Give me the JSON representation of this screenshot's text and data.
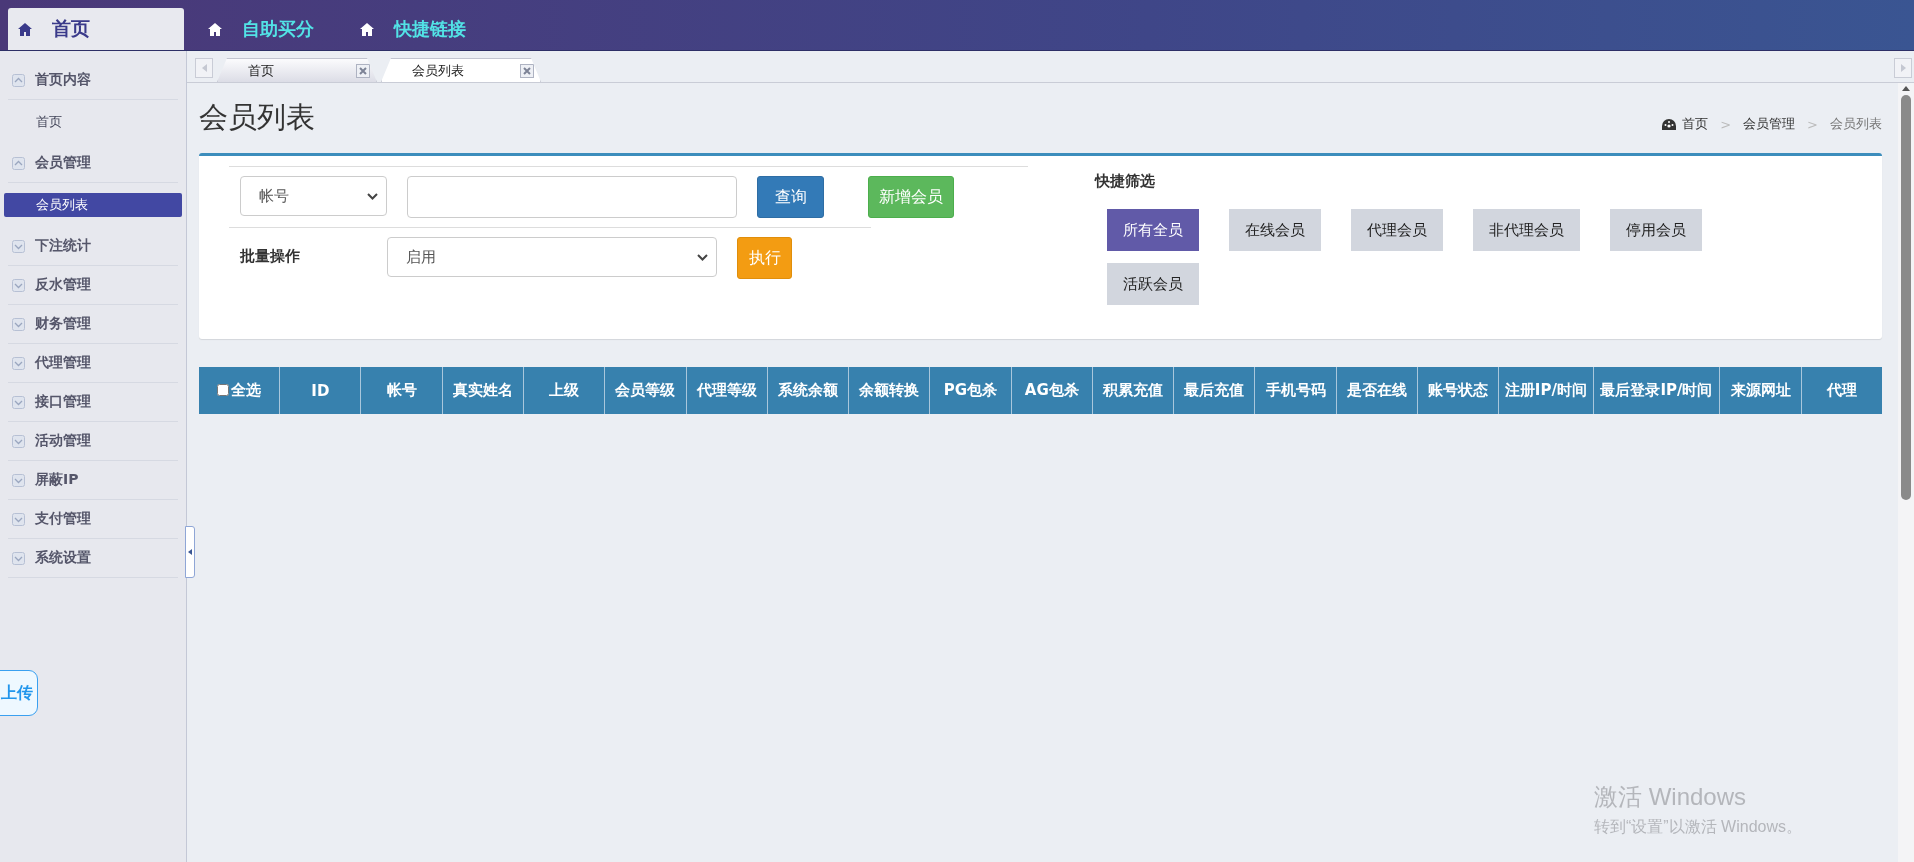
{
  "top_nav": [
    {
      "label": "首页",
      "selected": true
    },
    {
      "label": "自助买分",
      "selected": false
    },
    {
      "label": "快捷链接",
      "selected": false
    }
  ],
  "sidebar": {
    "groups": [
      {
        "label": "首页内容",
        "expanded": true,
        "children": [
          {
            "label": "首页",
            "selected": false
          }
        ]
      },
      {
        "label": "会员管理",
        "expanded": true,
        "children": [
          {
            "label": "会员列表",
            "selected": true
          }
        ]
      },
      {
        "label": "下注统计",
        "expanded": false
      },
      {
        "label": "反水管理",
        "expanded": false
      },
      {
        "label": "财务管理",
        "expanded": false
      },
      {
        "label": "代理管理",
        "expanded": false
      },
      {
        "label": "接口管理",
        "expanded": false
      },
      {
        "label": "活动管理",
        "expanded": false
      },
      {
        "label": "屏蔽IP",
        "expanded": false
      },
      {
        "label": "支付管理",
        "expanded": false
      },
      {
        "label": "系统设置",
        "expanded": false
      }
    ],
    "upload_button": "上传"
  },
  "page_tabs": [
    {
      "label": "首页",
      "selected": false
    },
    {
      "label": "会员列表",
      "selected": true
    }
  ],
  "page": {
    "title": "会员列表",
    "breadcrumb": [
      "首页",
      "会员管理",
      "会员列表"
    ],
    "breadcrumb_separator": ">"
  },
  "search": {
    "field_select": "帐号",
    "query_button": "查询",
    "add_button": "新增会员"
  },
  "batch": {
    "label": "批量操作",
    "action_select": "启用",
    "run_button": "执行"
  },
  "quick_filter": {
    "title": "快捷筛选",
    "filters": [
      {
        "label": "所有全员",
        "selected": true
      },
      {
        "label": "在线会员",
        "selected": false
      },
      {
        "label": "代理会员",
        "selected": false
      },
      {
        "label": "非代理会员",
        "selected": false
      },
      {
        "label": "停用会员",
        "selected": false
      },
      {
        "label": "活跃会员",
        "selected": false
      }
    ]
  },
  "table": {
    "select_all": {
      "label": "全选",
      "checked": false
    },
    "columns": [
      "ID",
      "帐号",
      "真实姓名",
      "上级",
      "会员等级",
      "代理等级",
      "系统余额",
      "余额转换",
      "PG包杀",
      "AG包杀",
      "积累充值",
      "最后充值",
      "手机号码",
      "是否在线",
      "账号状态",
      "注册IP/时间",
      "最后登录IP/时间",
      "来源网址",
      "代理"
    ]
  },
  "os_notice": {
    "title": "激活 Windows",
    "text": "转到“设置”以激活 Windows。"
  }
}
